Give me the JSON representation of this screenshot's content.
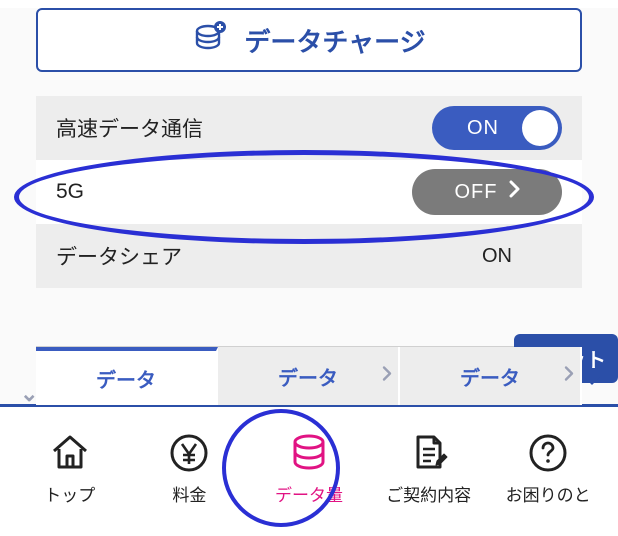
{
  "charge_button_label": "データチャージ",
  "settings": {
    "highspeed": {
      "label": "高速データ通信",
      "state": "ON"
    },
    "five_g": {
      "label": "5G",
      "state": "OFF"
    },
    "share": {
      "label": "データシェア",
      "state": "ON"
    }
  },
  "tabs": [
    {
      "label": "データ"
    },
    {
      "label": "データ"
    },
    {
      "label": "データ"
    }
  ],
  "chat_label": "チャット",
  "nav": [
    {
      "label": "トップ"
    },
    {
      "label": "料金"
    },
    {
      "label": "データ量"
    },
    {
      "label": "ご契約内容"
    },
    {
      "label": "お困りのと"
    }
  ],
  "colors": {
    "brand": "#2b4fa8",
    "accent": "#e11383",
    "annotation": "#2a2fd4"
  }
}
